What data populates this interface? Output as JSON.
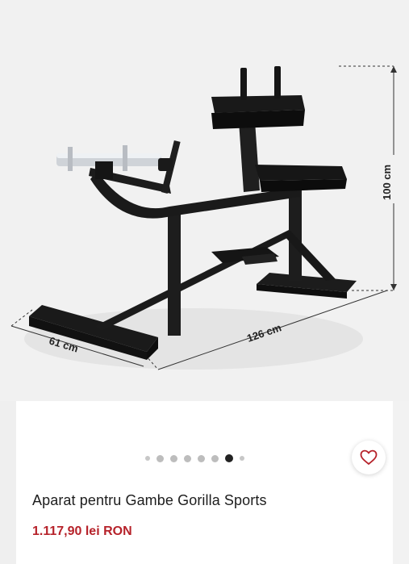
{
  "product_image": {
    "dimensions": {
      "height": "100 cm",
      "length": "126 cm",
      "width": "61 cm"
    }
  },
  "carousel": {
    "total_slides": 8,
    "active_index": 6
  },
  "favorite_button": {
    "icon": "heart-outline-icon"
  },
  "product": {
    "title": "Aparat pentru Gambe Gorilla Sports",
    "price": "1.117,90 lei RON"
  },
  "colors": {
    "price": "#b6222a",
    "active_dot": "#222222",
    "heart": "#b6222a"
  }
}
